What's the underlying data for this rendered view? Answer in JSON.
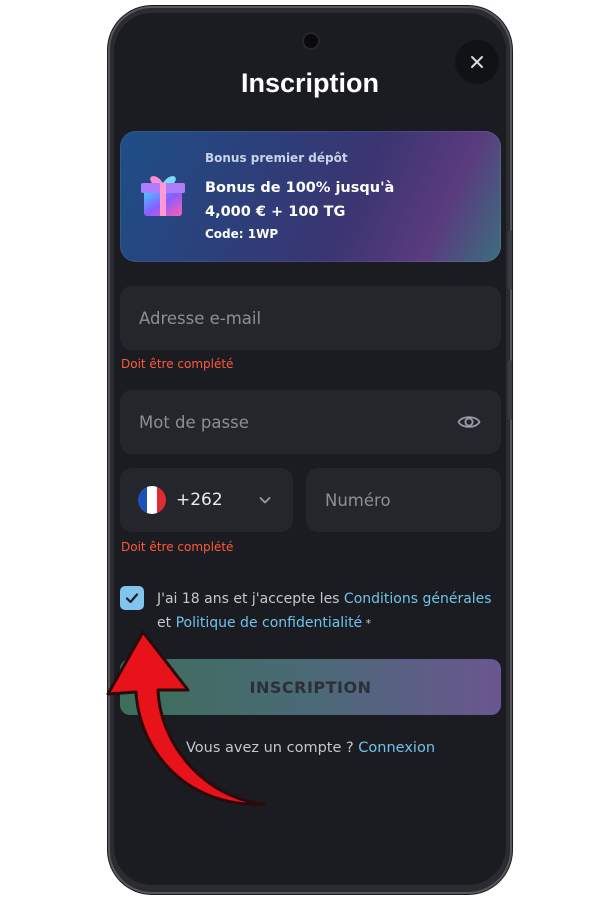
{
  "header": {
    "title": "Inscription"
  },
  "bonus": {
    "subtitle": "Bonus premier dépôt",
    "headline_line1": "Bonus de 100% jusqu'à",
    "headline_line2": "4,000 € + 100 TG",
    "code": "Code: 1WP"
  },
  "form": {
    "email_placeholder": "Adresse e-mail",
    "email_error": "Doit être complété",
    "password_placeholder": "Mot de passe",
    "phone_code": "+262",
    "phone_placeholder": "Numéro",
    "phone_error": "Doit être complété"
  },
  "terms": {
    "checked": true,
    "text_1": "J'ai 18 ans et j'accepte les ",
    "link_conditions": "Conditions générales",
    "text_2": "et ",
    "link_privacy": "Politique de confidentialité",
    "required_mark": " *"
  },
  "actions": {
    "submit_label": "INSCRIPTION",
    "have_account_text": "Vous avez un compte ? ",
    "login_link": "Connexion"
  },
  "colors": {
    "background": "#1b1c21",
    "field": "#25262c",
    "error": "#ff5a3a",
    "link": "#6fc3ea",
    "checkbox": "#7fc5ee",
    "annotation_arrow": "#e8121a"
  }
}
